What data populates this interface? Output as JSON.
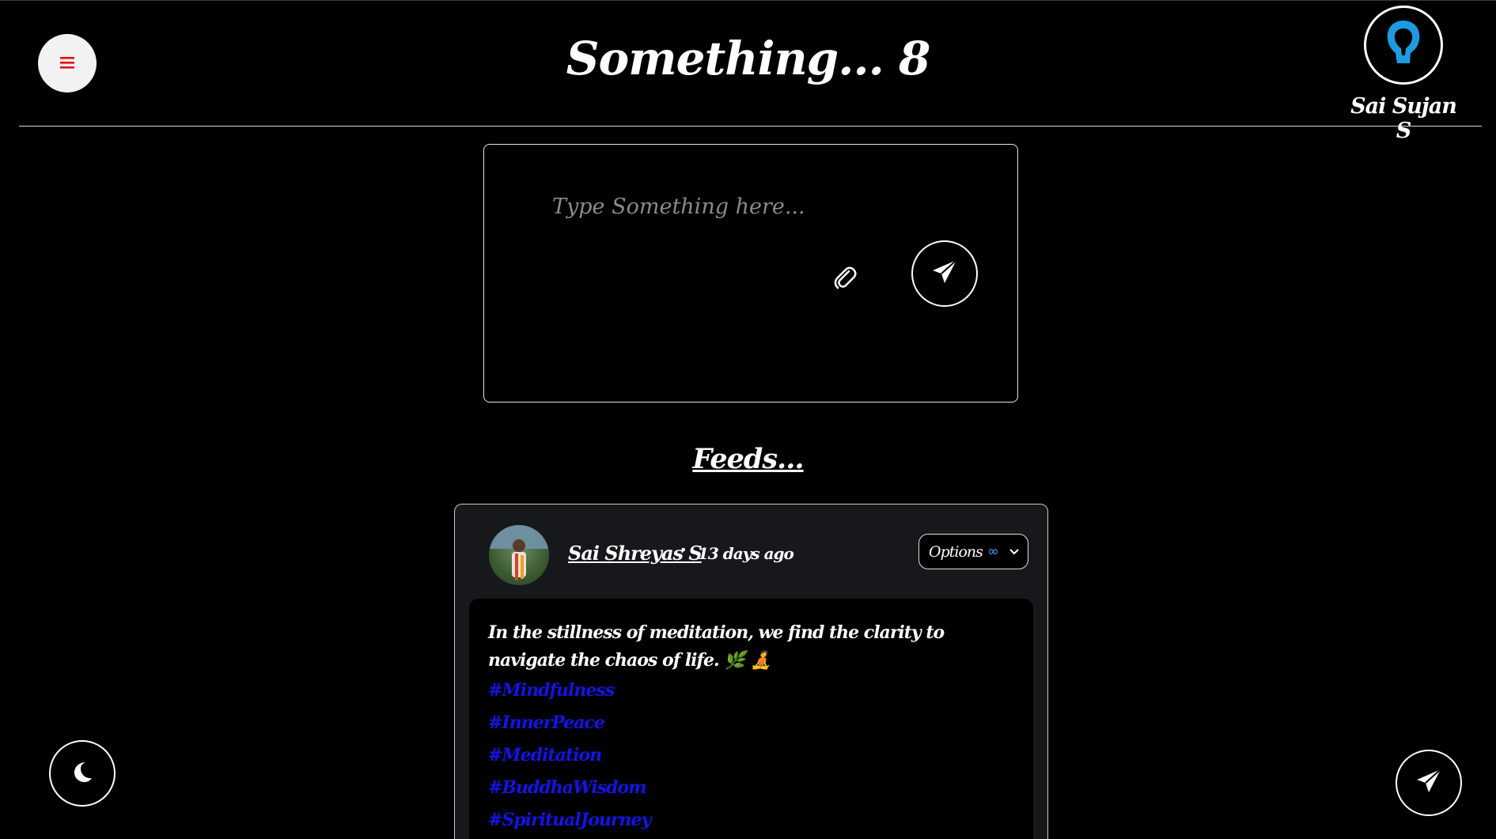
{
  "header": {
    "menu_icon": "hamburger-icon",
    "title": "Something... 8",
    "profile": {
      "name": "Sai Sujan S",
      "avatar_icon": "user-silhouette-icon"
    }
  },
  "composer": {
    "placeholder": "Type Something here...",
    "attach_icon": "paperclip-icon",
    "send_icon": "paper-plane-icon"
  },
  "feeds": {
    "title": "Feeds...",
    "posts": [
      {
        "author": "Sai Shreyas S",
        "separator": "•",
        "time": "13 days ago",
        "options_label": "Options",
        "options_symbol": "∞",
        "text": "In the stillness of meditation, we find the clarity to navigate the chaos of life. 🌿 🧘",
        "hashtags": [
          "#Mindfulness",
          "#InnerPeace",
          "#Meditation",
          "#BuddhaWisdom",
          "#SpiritualJourney"
        ]
      }
    ]
  },
  "floating": {
    "theme_icon": "moon-icon",
    "send_icon": "paper-plane-icon"
  },
  "colors": {
    "background": "#000000",
    "menu_icon": "#e01010",
    "hashtag": "#1414e6",
    "card": "#17181b",
    "accent": "#2fa4ff"
  }
}
